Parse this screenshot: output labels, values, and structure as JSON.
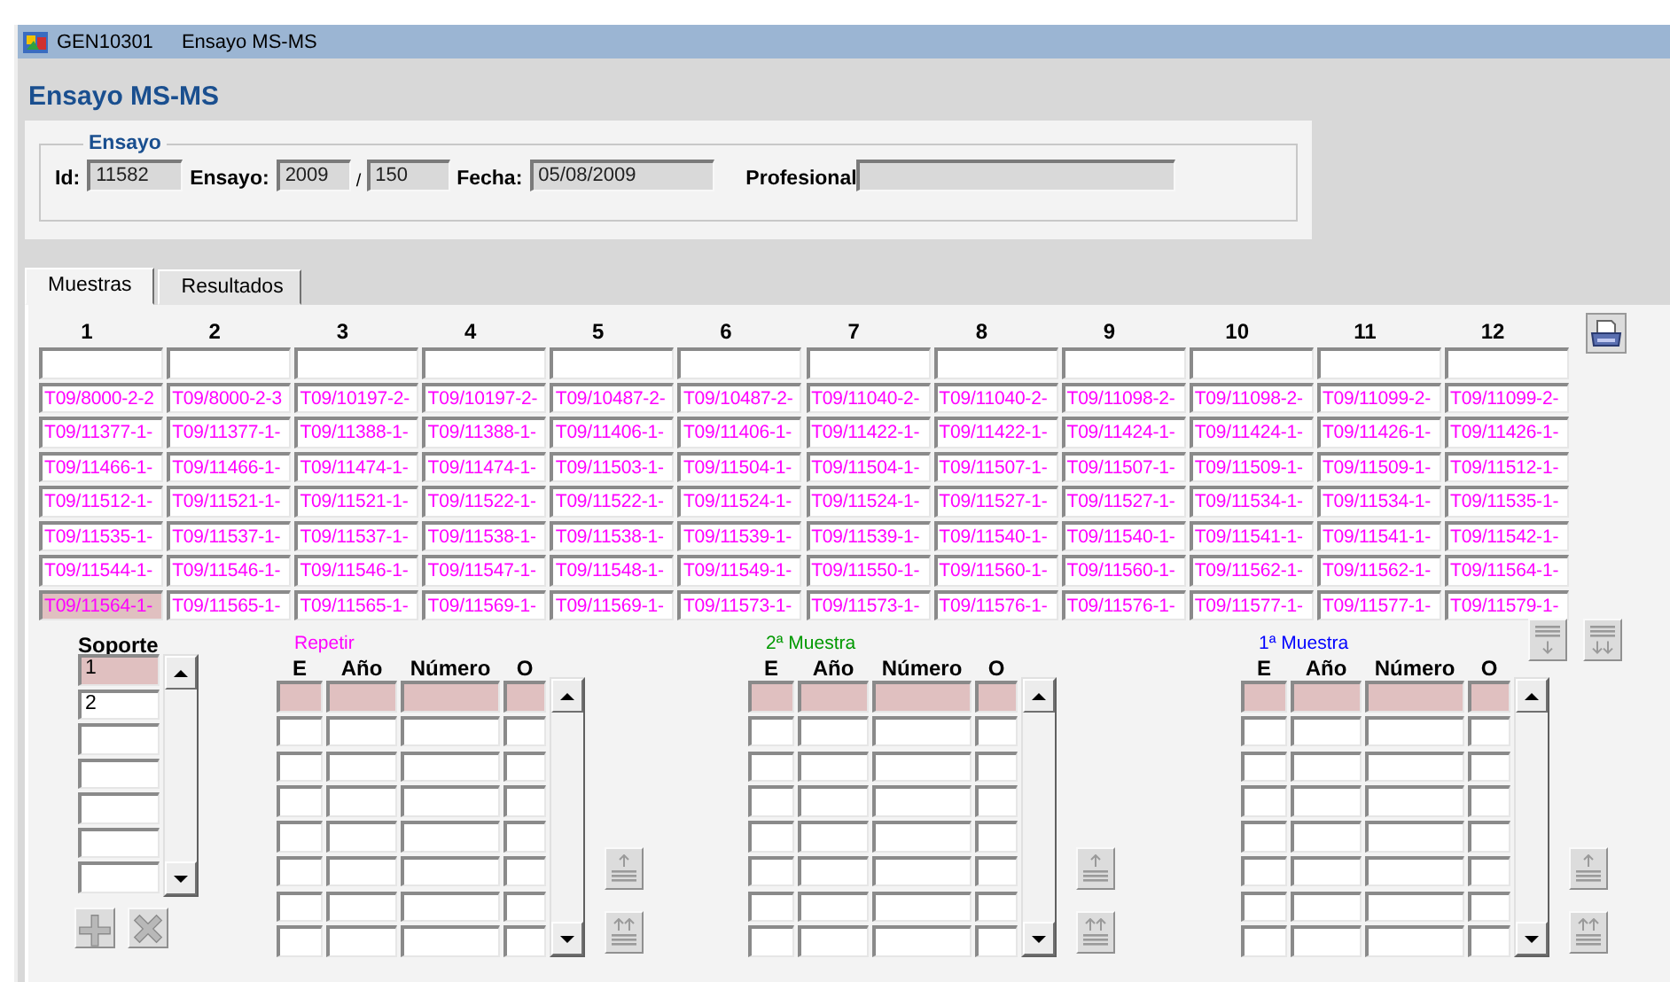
{
  "window": {
    "code": "GEN10301",
    "title": "Ensayo MS-MS"
  },
  "heading": "Ensayo MS-MS",
  "ensayo_group": {
    "legend": "Ensayo",
    "fields": [
      {
        "kind": "labeled",
        "label": "Id:",
        "value": "11582"
      },
      {
        "kind": "labeled",
        "label": "Ensayo:",
        "value": "2009"
      },
      {
        "kind": "continued",
        "label": "/",
        "value": "150"
      },
      {
        "kind": "labeled",
        "label": "Fecha:",
        "value": "05/08/2009"
      },
      {
        "kind": "labeled",
        "label": "Profesional"
      }
    ]
  },
  "tabs": [
    {
      "label": "Muestras",
      "selected": true
    },
    {
      "label": "Resultados",
      "selected": false
    }
  ],
  "grid": {
    "columns": [
      "1",
      "2",
      "3",
      "4",
      "5",
      "6",
      "7",
      "8",
      "9",
      "10",
      "11",
      "12"
    ],
    "rows": [
      [
        {
          "text": "T09/8000-2-2",
          "selected": false
        },
        {
          "text": "T09/8000-2-3",
          "selected": false
        },
        {
          "text": "T09/10197-2-",
          "selected": false
        },
        {
          "text": "T09/10197-2-",
          "selected": false
        },
        {
          "text": "T09/10487-2-",
          "selected": false
        },
        {
          "text": "T09/10487-2-",
          "selected": false
        },
        {
          "text": "T09/11040-2-",
          "selected": false
        },
        {
          "text": "T09/11040-2-",
          "selected": false
        },
        {
          "text": "T09/11098-2-",
          "selected": false
        },
        {
          "text": "T09/11098-2-",
          "selected": false
        },
        {
          "text": "T09/11099-2-",
          "selected": false
        },
        {
          "text": "T09/11099-2-",
          "selected": false
        }
      ],
      [
        {
          "text": "T09/11377-1-",
          "selected": false
        },
        {
          "text": "T09/11377-1-",
          "selected": false
        },
        {
          "text": "T09/11388-1-",
          "selected": false
        },
        {
          "text": "T09/11388-1-",
          "selected": false
        },
        {
          "text": "T09/11406-1-",
          "selected": false
        },
        {
          "text": "T09/11406-1-",
          "selected": false
        },
        {
          "text": "T09/11422-1-",
          "selected": false
        },
        {
          "text": "T09/11422-1-",
          "selected": false
        },
        {
          "text": "T09/11424-1-",
          "selected": false
        },
        {
          "text": "T09/11424-1-",
          "selected": false
        },
        {
          "text": "T09/11426-1-",
          "selected": false
        },
        {
          "text": "T09/11426-1-",
          "selected": false
        }
      ],
      [
        {
          "text": "T09/11466-1-",
          "selected": false
        },
        {
          "text": "T09/11466-1-",
          "selected": false
        },
        {
          "text": "T09/11474-1-",
          "selected": false
        },
        {
          "text": "T09/11474-1-",
          "selected": false
        },
        {
          "text": "T09/11503-1-",
          "selected": false
        },
        {
          "text": "T09/11504-1-",
          "selected": false
        },
        {
          "text": "T09/11504-1-",
          "selected": false
        },
        {
          "text": "T09/11507-1-",
          "selected": false
        },
        {
          "text": "T09/11507-1-",
          "selected": false
        },
        {
          "text": "T09/11509-1-",
          "selected": false
        },
        {
          "text": "T09/11509-1-",
          "selected": false
        },
        {
          "text": "T09/11512-1-",
          "selected": false
        }
      ],
      [
        {
          "text": "T09/11512-1-",
          "selected": false
        },
        {
          "text": "T09/11521-1-",
          "selected": false
        },
        {
          "text": "T09/11521-1-",
          "selected": false
        },
        {
          "text": "T09/11522-1-",
          "selected": false
        },
        {
          "text": "T09/11522-1-",
          "selected": false
        },
        {
          "text": "T09/11524-1-",
          "selected": false
        },
        {
          "text": "T09/11524-1-",
          "selected": false
        },
        {
          "text": "T09/11527-1-",
          "selected": false
        },
        {
          "text": "T09/11527-1-",
          "selected": false
        },
        {
          "text": "T09/11534-1-",
          "selected": false
        },
        {
          "text": "T09/11534-1-",
          "selected": false
        },
        {
          "text": "T09/11535-1-",
          "selected": false
        }
      ],
      [
        {
          "text": "T09/11535-1-",
          "selected": false
        },
        {
          "text": "T09/11537-1-",
          "selected": false
        },
        {
          "text": "T09/11537-1-",
          "selected": false
        },
        {
          "text": "T09/11538-1-",
          "selected": false
        },
        {
          "text": "T09/11538-1-",
          "selected": false
        },
        {
          "text": "T09/11539-1-",
          "selected": false
        },
        {
          "text": "T09/11539-1-",
          "selected": false
        },
        {
          "text": "T09/11540-1-",
          "selected": false
        },
        {
          "text": "T09/11540-1-",
          "selected": false
        },
        {
          "text": "T09/11541-1-",
          "selected": false
        },
        {
          "text": "T09/11541-1-",
          "selected": false
        },
        {
          "text": "T09/11542-1-",
          "selected": false
        }
      ],
      [
        {
          "text": "T09/11544-1-",
          "selected": false
        },
        {
          "text": "T09/11546-1-",
          "selected": false
        },
        {
          "text": "T09/11546-1-",
          "selected": false
        },
        {
          "text": "T09/11547-1-",
          "selected": false
        },
        {
          "text": "T09/11548-1-",
          "selected": false
        },
        {
          "text": "T09/11549-1-",
          "selected": false
        },
        {
          "text": "T09/11550-1-",
          "selected": false
        },
        {
          "text": "T09/11560-1-",
          "selected": false
        },
        {
          "text": "T09/11560-1-",
          "selected": false
        },
        {
          "text": "T09/11562-1-",
          "selected": false
        },
        {
          "text": "T09/11562-1-",
          "selected": false
        },
        {
          "text": "T09/11564-1-",
          "selected": false
        }
      ],
      [
        {
          "text": "T09/11564-1-",
          "selected": true
        },
        {
          "text": "T09/11565-1-",
          "selected": false
        },
        {
          "text": "T09/11565-1-",
          "selected": false
        },
        {
          "text": "T09/11569-1-",
          "selected": false
        },
        {
          "text": "T09/11569-1-",
          "selected": false
        },
        {
          "text": "T09/11573-1-",
          "selected": false
        },
        {
          "text": "T09/11573-1-",
          "selected": false
        },
        {
          "text": "T09/11576-1-",
          "selected": false
        },
        {
          "text": "T09/11576-1-",
          "selected": false
        },
        {
          "text": "T09/11577-1-",
          "selected": false
        },
        {
          "text": "T09/11577-1-",
          "selected": false
        },
        {
          "text": "T09/11579-1-",
          "selected": false
        }
      ]
    ]
  },
  "soporte": {
    "label": "Soporte",
    "items": [
      {
        "value": "1",
        "selected": true
      },
      {
        "value": "2",
        "selected": false
      }
    ],
    "buttons": [
      {
        "kind": "add",
        "disabled": true
      },
      {
        "kind": "delete",
        "disabled": true
      }
    ]
  },
  "tables": [
    {
      "title": "Repetir",
      "color": "#ff00ff",
      "columns": [
        "E",
        "Año",
        "Número",
        "O"
      ]
    },
    {
      "title": "2ª Muestra",
      "color": "#009900",
      "columns": [
        "E",
        "Año",
        "Número",
        "O"
      ]
    },
    {
      "title": "1ª Muestra",
      "color": "#0000ff",
      "columns": [
        "E",
        "Año",
        "Número",
        "O"
      ]
    }
  ]
}
